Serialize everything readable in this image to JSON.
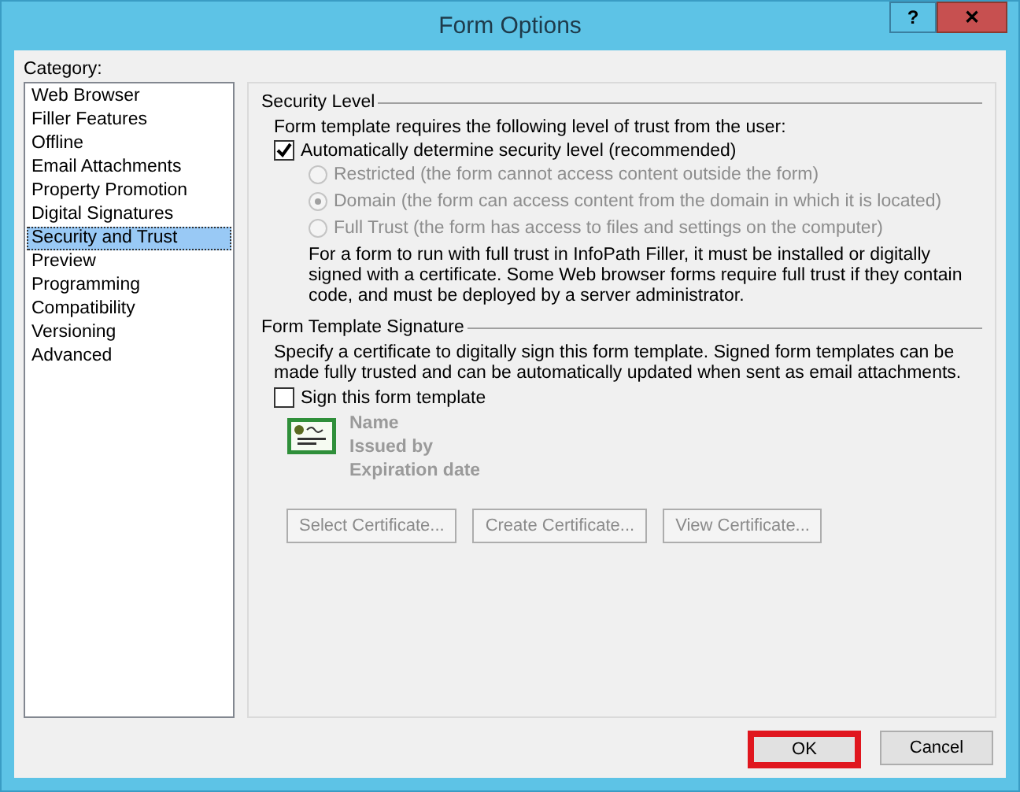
{
  "window": {
    "title": "Form Options",
    "help_button": "?",
    "close_button": "✕"
  },
  "category": {
    "label": "Category:",
    "items": [
      {
        "label": "Web Browser",
        "selected": false
      },
      {
        "label": "Filler Features",
        "selected": false
      },
      {
        "label": "Offline",
        "selected": false
      },
      {
        "label": "Email Attachments",
        "selected": false
      },
      {
        "label": "Property Promotion",
        "selected": false
      },
      {
        "label": "Digital Signatures",
        "selected": false
      },
      {
        "label": "Security and Trust",
        "selected": true
      },
      {
        "label": "Preview",
        "selected": false
      },
      {
        "label": "Programming",
        "selected": false
      },
      {
        "label": "Compatibility",
        "selected": false
      },
      {
        "label": "Versioning",
        "selected": false
      },
      {
        "label": "Advanced",
        "selected": false
      }
    ]
  },
  "security_level": {
    "title": "Security Level",
    "intro": "Form template requires the following level of trust from the user:",
    "auto_checkbox": {
      "label": "Automatically determine security level (recommended)",
      "checked": true
    },
    "options": [
      {
        "label": "Restricted (the form cannot access content outside the form)",
        "selected": false,
        "disabled": true
      },
      {
        "label": "Domain (the form can access content from the domain in which it is located)",
        "selected": true,
        "disabled": true
      },
      {
        "label": "Full Trust (the form has access to files and settings on the computer)",
        "selected": false,
        "disabled": true
      }
    ],
    "note": "For a form to run with full trust in InfoPath Filler, it must be installed or digitally signed with a certificate. Some Web browser forms require full trust if they contain code, and must be deployed by a server administrator."
  },
  "signature": {
    "title": "Form Template Signature",
    "intro": "Specify a certificate to digitally sign this form template. Signed form templates can be made fully trusted and can be automatically updated when sent as email attachments.",
    "sign_checkbox": {
      "label": "Sign this form template",
      "checked": false
    },
    "certificate_fields": [
      {
        "label": "Name",
        "disabled": true
      },
      {
        "label": "Issued by",
        "disabled": true
      },
      {
        "label": "Expiration date",
        "disabled": true
      }
    ],
    "buttons": [
      {
        "label": "Select Certificate...",
        "disabled": true
      },
      {
        "label": "Create Certificate...",
        "disabled": true
      },
      {
        "label": "View Certificate...",
        "disabled": true
      }
    ]
  },
  "footer_buttons": [
    {
      "label": "OK",
      "highlighted": true
    },
    {
      "label": "Cancel",
      "highlighted": false
    }
  ]
}
